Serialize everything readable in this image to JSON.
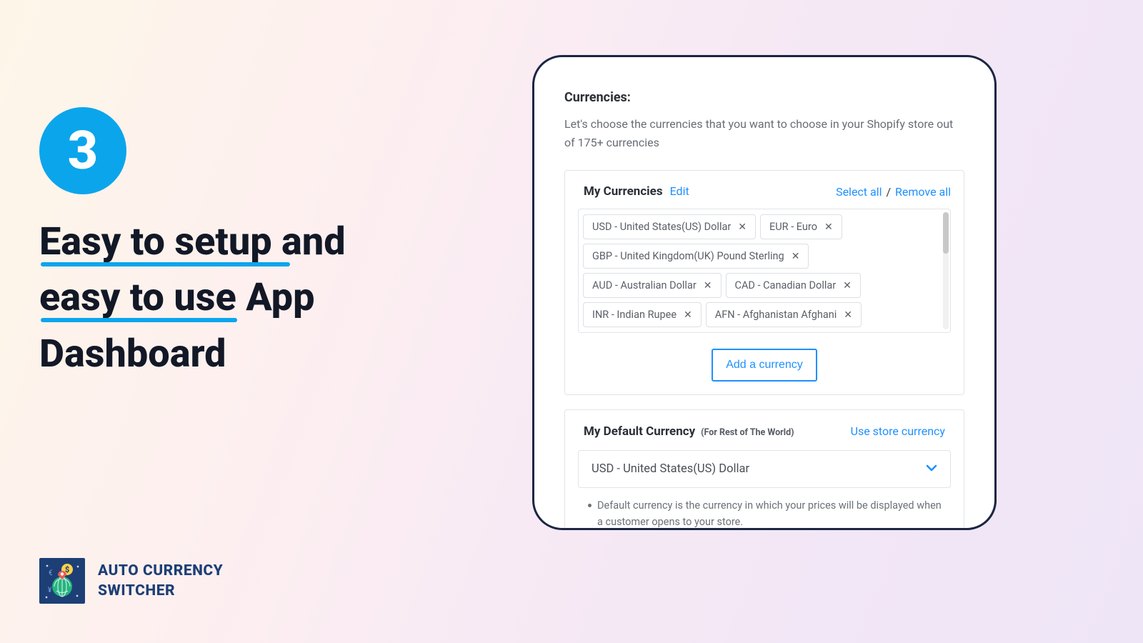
{
  "step": "3",
  "headline_line1": "Easy to setup and",
  "headline_line2": "easy to use App",
  "headline_line3": "Dashboard",
  "brand_line1": "AUTO CURRENCY",
  "brand_line2": "SWITCHER",
  "panel": {
    "title": "Currencies:",
    "desc": "Let's choose the currencies that you want to choose in your Shopify store out of 175+ currencies",
    "my_currencies_label": "My Currencies",
    "edit": "Edit",
    "select_all": "Select all",
    "sep": "/",
    "remove_all": "Remove all",
    "chips": [
      "USD - United States(US) Dollar",
      "EUR - Euro",
      "GBP - United Kingdom(UK) Pound Sterling",
      "AUD - Australian Dollar",
      "CAD - Canadian Dollar",
      "INR - Indian Rupee",
      "AFN - Afghanistan Afghani"
    ],
    "add_currency": "Add a currency",
    "default_label": "My Default Currency",
    "default_hint": "(For Rest of The World)",
    "use_store": "Use store currency",
    "default_value": "USD - United States(US) Dollar",
    "bullet": "Default currency is the currency in which your prices will be displayed when a customer opens to your store."
  }
}
